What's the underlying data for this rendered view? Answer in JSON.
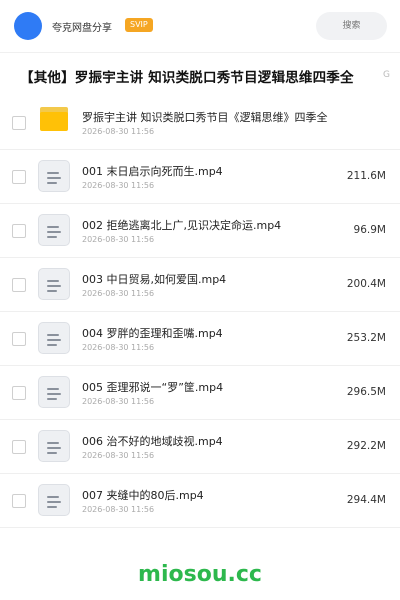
{
  "header": {
    "app_name": "夸克网盘分享",
    "badge": "SVIP",
    "search_placeholder": "搜索"
  },
  "title": "【其他】罗振宇主讲 知识类脱口秀节目逻辑思维四季全",
  "title_overflow_text": "G",
  "colors": {
    "accent": "#2f7bf5",
    "badge": "#f5a623",
    "folder": "#ffc107",
    "watermark": "#2db84d"
  },
  "items": [
    {
      "type": "folder",
      "icon": "folder-icon",
      "name": "罗振宇主讲 知识类脱口秀节目《逻辑思维》四季全",
      "date": "2026-08-30 11:56",
      "size": ""
    },
    {
      "type": "file",
      "icon": "document-icon",
      "name": "001 末日启示向死而生.mp4",
      "date": "2026-08-30 11:56",
      "size": "211.6M"
    },
    {
      "type": "file",
      "icon": "document-icon",
      "name": "002 拒绝逃离北上广,见识决定命运.mp4",
      "date": "2026-08-30 11:56",
      "size": "96.9M"
    },
    {
      "type": "file",
      "icon": "document-icon",
      "name": "003 中日贸易,如何爱国.mp4",
      "date": "2026-08-30 11:56",
      "size": "200.4M"
    },
    {
      "type": "file",
      "icon": "document-icon",
      "name": "004 罗胖的歪理和歪嘴.mp4",
      "date": "2026-08-30 11:56",
      "size": "253.2M"
    },
    {
      "type": "file",
      "icon": "document-icon",
      "name": "005 歪理邪说一“罗”筐.mp4",
      "date": "2026-08-30 11:56",
      "size": "296.5M"
    },
    {
      "type": "file",
      "icon": "document-icon",
      "name": "006 治不好的地域歧视.mp4",
      "date": "2026-08-30 11:56",
      "size": "292.2M"
    },
    {
      "type": "file",
      "icon": "document-icon",
      "name": "007 夹缝中的80后.mp4",
      "date": "2026-08-30 11:56",
      "size": "294.4M"
    }
  ],
  "watermark": "miosou.cc"
}
